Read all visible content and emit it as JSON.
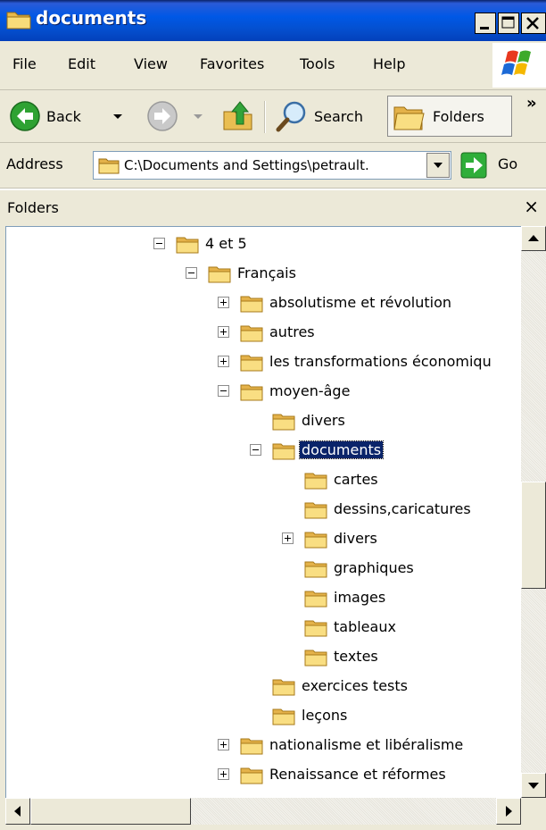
{
  "window": {
    "title": "documents"
  },
  "menu": [
    "File",
    "Edit",
    "View",
    "Favorites",
    "Tools",
    "Help"
  ],
  "toolbar": {
    "back": "Back",
    "search": "Search",
    "folders": "Folders",
    "more": "»"
  },
  "address": {
    "label": "Address",
    "value": "C:\\Documents and Settings\\petrault.",
    "go": "Go"
  },
  "pane": {
    "title": "Folders",
    "close": "×"
  },
  "tree": [
    {
      "label": "4 et 5",
      "level": 0,
      "expander": "minus"
    },
    {
      "label": "Français",
      "level": 1,
      "expander": "minus"
    },
    {
      "label": "absolutisme et révolution",
      "level": 2,
      "expander": "plus"
    },
    {
      "label": "autres",
      "level": 2,
      "expander": "plus"
    },
    {
      "label": "les transformations économiqu",
      "level": 2,
      "expander": "plus"
    },
    {
      "label": "moyen-âge",
      "level": 2,
      "expander": "minus"
    },
    {
      "label": "divers",
      "level": 3,
      "expander": "none"
    },
    {
      "label": "documents",
      "level": 3,
      "expander": "minus",
      "selected": true
    },
    {
      "label": "cartes",
      "level": 4,
      "expander": "none"
    },
    {
      "label": "dessins,caricatures",
      "level": 4,
      "expander": "none"
    },
    {
      "label": "divers",
      "level": 4,
      "expander": "plus"
    },
    {
      "label": "graphiques",
      "level": 4,
      "expander": "none"
    },
    {
      "label": "images",
      "level": 4,
      "expander": "none"
    },
    {
      "label": "tableaux",
      "level": 4,
      "expander": "none"
    },
    {
      "label": "textes",
      "level": 4,
      "expander": "none"
    },
    {
      "label": "exercices tests",
      "level": 3,
      "expander": "none"
    },
    {
      "label": "leçons",
      "level": 3,
      "expander": "none"
    },
    {
      "label": "nationalisme et libéralisme",
      "level": 2,
      "expander": "plus"
    },
    {
      "label": "Renaissance et réformes",
      "level": 2,
      "expander": "plus"
    }
  ],
  "colors": {
    "titlebar": "#0058E6",
    "selection": "#0A246A",
    "folder": "#F6D66A"
  }
}
